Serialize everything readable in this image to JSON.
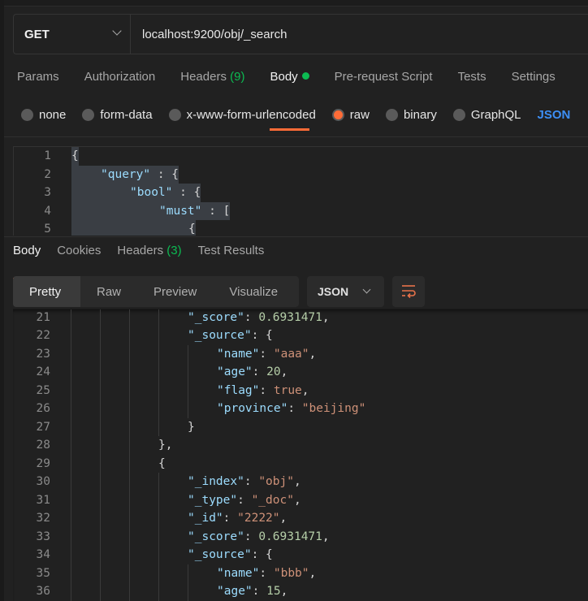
{
  "request": {
    "method": "GET",
    "url": "localhost:9200/obj/_search"
  },
  "request_tabs": [
    {
      "label": "Params"
    },
    {
      "label": "Authorization"
    },
    {
      "label": "Headers",
      "count": "(9)"
    },
    {
      "label": "Body",
      "active": true,
      "indicator": "green-dot"
    },
    {
      "label": "Pre-request Script"
    },
    {
      "label": "Tests"
    },
    {
      "label": "Settings"
    }
  ],
  "body_types": [
    {
      "label": "none"
    },
    {
      "label": "form-data"
    },
    {
      "label": "x-www-form-urlencoded"
    },
    {
      "label": "raw",
      "selected": true
    },
    {
      "label": "binary"
    },
    {
      "label": "GraphQL"
    }
  ],
  "raw_format": "JSON",
  "request_body": [
    {
      "n": "1",
      "indent": 0,
      "parts": [
        [
          "p",
          "{"
        ]
      ]
    },
    {
      "n": "2",
      "indent": 1,
      "parts": [
        [
          "k",
          "\"query\""
        ],
        [
          "p",
          " : {"
        ]
      ]
    },
    {
      "n": "3",
      "indent": 2,
      "parts": [
        [
          "k",
          "\"bool\""
        ],
        [
          "p",
          " : {"
        ]
      ]
    },
    {
      "n": "4",
      "indent": 3,
      "parts": [
        [
          "k",
          "\"must\""
        ],
        [
          "p",
          " : ["
        ]
      ]
    },
    {
      "n": "5",
      "indent": 4,
      "parts": [
        [
          "p",
          "{"
        ]
      ]
    }
  ],
  "response_tabs": [
    {
      "label": "Body",
      "active": true
    },
    {
      "label": "Cookies"
    },
    {
      "label": "Headers",
      "count": "(3)"
    },
    {
      "label": "Test Results"
    }
  ],
  "view_modes": [
    "Pretty",
    "Raw",
    "Preview",
    "Visualize"
  ],
  "response_format": "JSON",
  "response_body": [
    {
      "n": "21",
      "indent": 4,
      "parts": [
        [
          "k",
          "\"_score\""
        ],
        [
          "p",
          ": "
        ],
        [
          "n",
          "0.6931471"
        ],
        [
          "p",
          ","
        ]
      ]
    },
    {
      "n": "22",
      "indent": 4,
      "parts": [
        [
          "k",
          "\"_source\""
        ],
        [
          "p",
          ": {"
        ]
      ]
    },
    {
      "n": "23",
      "indent": 5,
      "parts": [
        [
          "k",
          "\"name\""
        ],
        [
          "p",
          ": "
        ],
        [
          "s",
          "\"aaa\""
        ],
        [
          "p",
          ","
        ]
      ]
    },
    {
      "n": "24",
      "indent": 5,
      "parts": [
        [
          "k",
          "\"age\""
        ],
        [
          "p",
          ": "
        ],
        [
          "n",
          "20"
        ],
        [
          "p",
          ","
        ]
      ]
    },
    {
      "n": "25",
      "indent": 5,
      "parts": [
        [
          "k",
          "\"flag\""
        ],
        [
          "p",
          ": "
        ],
        [
          "b",
          "true"
        ],
        [
          "p",
          ","
        ]
      ]
    },
    {
      "n": "26",
      "indent": 5,
      "parts": [
        [
          "k",
          "\"province\""
        ],
        [
          "p",
          ": "
        ],
        [
          "s",
          "\"beijing\""
        ]
      ]
    },
    {
      "n": "27",
      "indent": 4,
      "parts": [
        [
          "p",
          "}"
        ]
      ]
    },
    {
      "n": "28",
      "indent": 3,
      "parts": [
        [
          "p",
          "},"
        ]
      ]
    },
    {
      "n": "29",
      "indent": 3,
      "parts": [
        [
          "p",
          "{"
        ]
      ]
    },
    {
      "n": "30",
      "indent": 4,
      "parts": [
        [
          "k",
          "\"_index\""
        ],
        [
          "p",
          ": "
        ],
        [
          "s",
          "\"obj\""
        ],
        [
          "p",
          ","
        ]
      ]
    },
    {
      "n": "31",
      "indent": 4,
      "parts": [
        [
          "k",
          "\"_type\""
        ],
        [
          "p",
          ": "
        ],
        [
          "s",
          "\"_doc\""
        ],
        [
          "p",
          ","
        ]
      ]
    },
    {
      "n": "32",
      "indent": 4,
      "parts": [
        [
          "k",
          "\"_id\""
        ],
        [
          "p",
          ": "
        ],
        [
          "s",
          "\"2222\""
        ],
        [
          "p",
          ","
        ]
      ]
    },
    {
      "n": "33",
      "indent": 4,
      "parts": [
        [
          "k",
          "\"_score\""
        ],
        [
          "p",
          ": "
        ],
        [
          "n",
          "0.6931471"
        ],
        [
          "p",
          ","
        ]
      ]
    },
    {
      "n": "34",
      "indent": 4,
      "parts": [
        [
          "k",
          "\"_source\""
        ],
        [
          "p",
          ": {"
        ]
      ]
    },
    {
      "n": "35",
      "indent": 5,
      "parts": [
        [
          "k",
          "\"name\""
        ],
        [
          "p",
          ": "
        ],
        [
          "s",
          "\"bbb\""
        ],
        [
          "p",
          ","
        ]
      ]
    },
    {
      "n": "36",
      "indent": 5,
      "parts": [
        [
          "k",
          "\"age\""
        ],
        [
          "p",
          ": "
        ],
        [
          "n",
          "15"
        ],
        [
          "p",
          ","
        ]
      ]
    }
  ],
  "colors": {
    "accent": "#ff6c37",
    "success": "#0cbb52",
    "link": "#3d8ff5"
  }
}
